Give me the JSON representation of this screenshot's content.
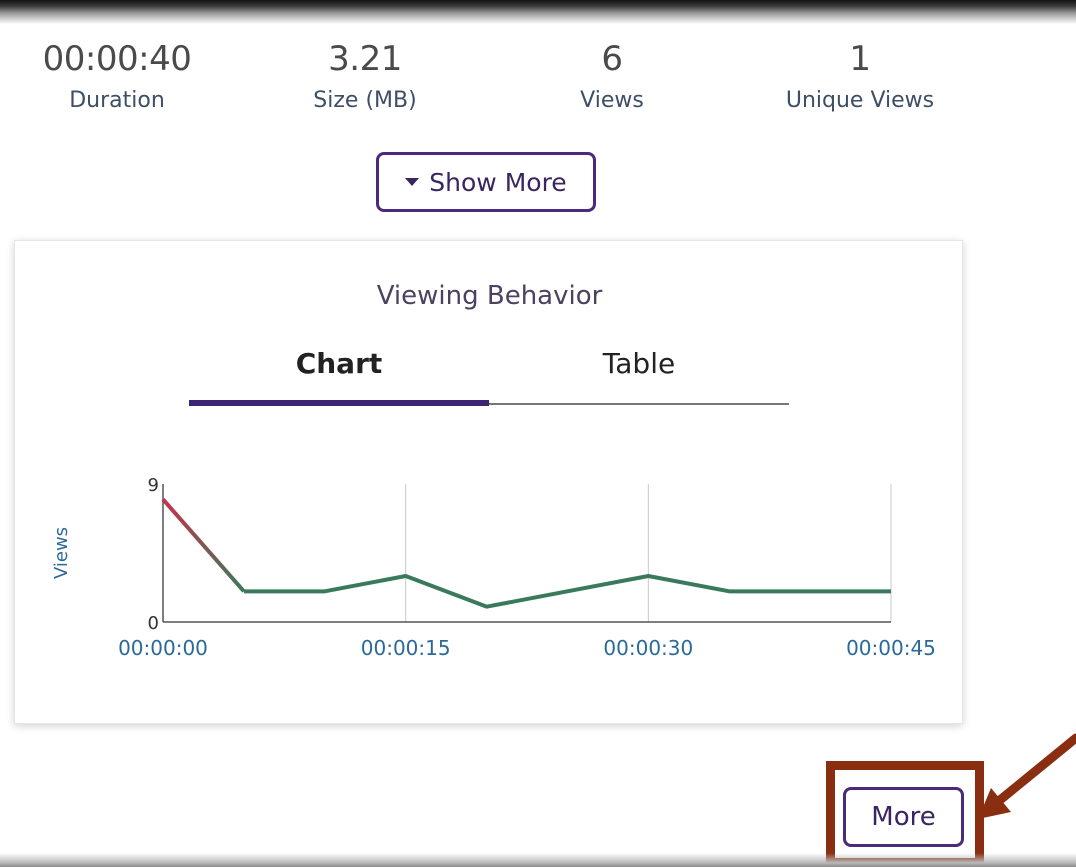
{
  "stats": [
    {
      "value": "00:00:40",
      "label": "Duration"
    },
    {
      "value": "3.21",
      "label": "Size (MB)"
    },
    {
      "value": "6",
      "label": "Views"
    },
    {
      "value": "1",
      "label": "Unique Views"
    }
  ],
  "show_more": {
    "label": "Show More",
    "icon": "caret-down-icon"
  },
  "card": {
    "title": "Viewing Behavior",
    "tabs": [
      {
        "label": "Chart",
        "active": true
      },
      {
        "label": "Table",
        "active": false
      }
    ]
  },
  "chart_data": {
    "type": "line",
    "title": "",
    "xlabel": "",
    "ylabel": "Views",
    "x_ticks": [
      "00:00:00",
      "00:00:15",
      "00:00:30",
      "00:00:45"
    ],
    "y_ticks": [
      "0",
      "9"
    ],
    "ylim": [
      0,
      9
    ],
    "xlim": [
      "00:00:00",
      "00:00:45"
    ],
    "grid": "vertical",
    "series": [
      {
        "x": [
          "00:00:00",
          "00:00:05",
          "00:00:10",
          "00:00:15",
          "00:00:20",
          "00:00:25",
          "00:00:30",
          "00:00:35",
          "00:00:40",
          "00:00:45"
        ],
        "values": [
          8,
          2,
          2,
          3,
          1,
          2,
          3,
          2,
          2,
          2
        ],
        "color": "#3a7a5c",
        "start_color": "#c4344a"
      }
    ]
  },
  "more_button": {
    "label": "More"
  },
  "annotation": {
    "color": "#8a2e12"
  }
}
